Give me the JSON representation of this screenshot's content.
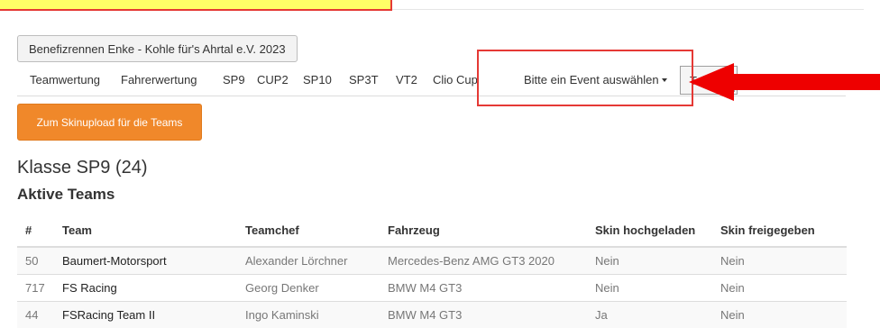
{
  "event_button": {
    "label": "Benefizrennen Enke - Kohle für's Ahrtal e.V. 2023"
  },
  "nav": {
    "items": [
      "Teamwertung",
      "Fahrerwertung",
      "SP9",
      "CUP2",
      "SP10",
      "SP3T",
      "VT2",
      "Clio Cup"
    ],
    "event_dropdown": "Bitte ein Event auswählen",
    "team_select": "Tea"
  },
  "skin_button": {
    "label": "Zum Skinupload für die Teams"
  },
  "class_heading": "Klasse SP9 (24)",
  "sub_heading": "Aktive Teams",
  "table": {
    "headers": [
      "#",
      "Team",
      "Teamchef",
      "Fahrzeug",
      "Skin hochgeladen",
      "Skin freigegeben"
    ],
    "rows": [
      [
        "50",
        "Baumert-Motorsport",
        "Alexander Lörchner",
        "Mercedes-Benz AMG GT3 2020",
        "Nein",
        "Nein"
      ],
      [
        "717",
        "FS Racing",
        "Georg Denker",
        "BMW M4 GT3",
        "Nein",
        "Nein"
      ],
      [
        "44",
        "FSRacing Team II",
        "Ingo Kaminski",
        "BMW M4 GT3",
        "Ja",
        "Nein"
      ]
    ]
  },
  "colors": {
    "accent_orange": "#f0882a",
    "highlight_red": "#e53935",
    "banner_yellow": "#ffff66"
  }
}
